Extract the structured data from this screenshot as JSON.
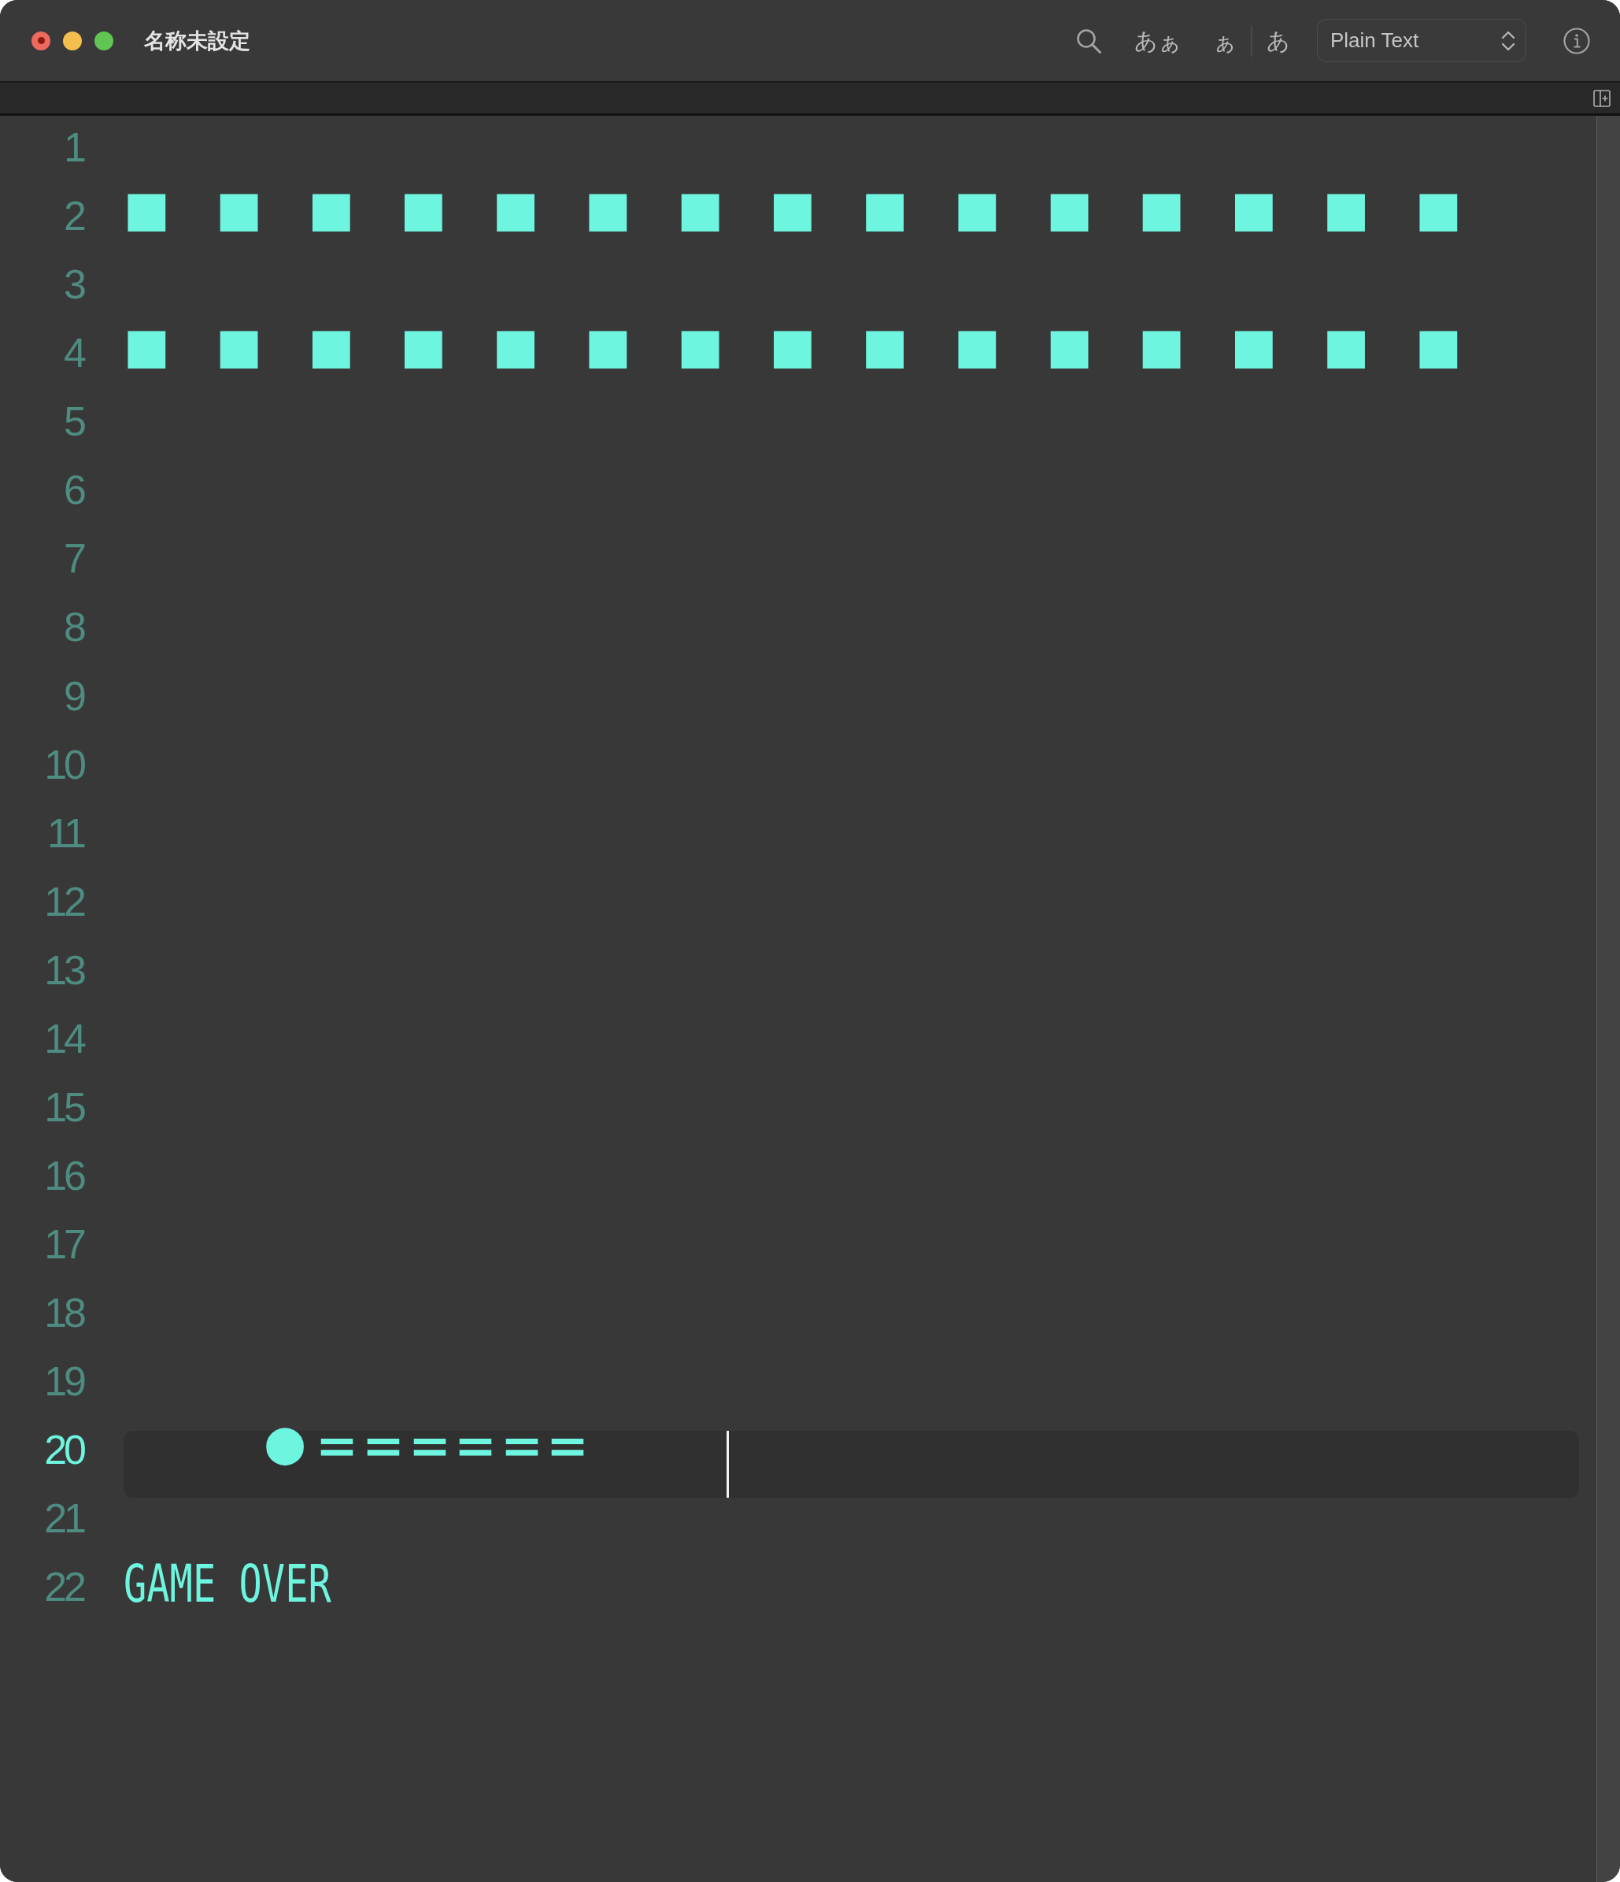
{
  "window": {
    "title": "名称未設定",
    "unsaved": true
  },
  "toolbar": {
    "text_button_groups": [
      [
        "あぁ"
      ],
      [
        "ぁ",
        "あ"
      ]
    ],
    "syntax_popup": {
      "value": "Plain Text"
    }
  },
  "editor": {
    "lines": [
      {
        "number": "1",
        "current": false
      },
      {
        "number": "2",
        "text": "■  ■  ■  ■  ■  ■  ■  ■  ■  ■  ■  ■  ■  ■  ■",
        "current": false
      },
      {
        "number": "3",
        "current": false
      },
      {
        "number": "4",
        "text": "■  ■  ■  ■  ■  ■  ■  ■  ■  ■  ■  ■  ■  ■  ■",
        "current": false
      },
      {
        "number": "5",
        "current": false
      },
      {
        "number": "6",
        "current": false
      },
      {
        "number": "7",
        "current": false
      },
      {
        "number": "8",
        "current": false
      },
      {
        "number": "9",
        "current": false
      },
      {
        "number": "10",
        "current": false
      },
      {
        "number": "11",
        "current": false
      },
      {
        "number": "12",
        "current": false
      },
      {
        "number": "13",
        "current": false
      },
      {
        "number": "14",
        "current": false
      },
      {
        "number": "15",
        "current": false
      },
      {
        "number": "16",
        "current": false
      },
      {
        "number": "17",
        "current": false
      },
      {
        "number": "18",
        "current": false
      },
      {
        "number": "19",
        "current": false
      },
      {
        "number": "20",
        "text": "      ●＝＝＝＝＝＝      ",
        "current": true
      },
      {
        "number": "21",
        "current": false
      },
      {
        "number": "22",
        "text": "GAME OVER",
        "current": false
      }
    ]
  }
}
